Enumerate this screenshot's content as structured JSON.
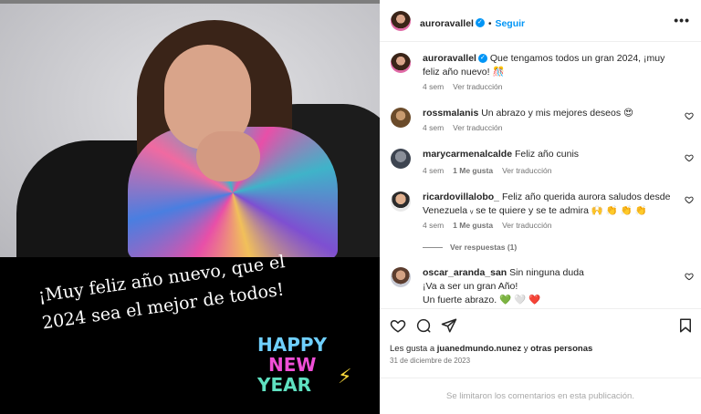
{
  "media": {
    "greeting_line1": "¡Muy feliz año nuevo, que el",
    "greeting_line2": "2024 sea el mejor de todos!",
    "badge_line1": "HAPPY",
    "badge_line2": "NEW",
    "badge_line3": "YEAR"
  },
  "header": {
    "username": "auroravallel",
    "follow_label": "Seguir",
    "more_icon": "more-horizontal-icon"
  },
  "caption": {
    "username": "auroravallel",
    "text": "Que tengamos todos un gran 2024, ¡muy feliz año nuevo! 🎊",
    "time": "4 sem",
    "translate": "Ver traducción"
  },
  "comments": [
    {
      "username": "rossmalanis",
      "text": "Un abrazo y mis mejores deseos 😍",
      "time": "4 sem",
      "likes": "",
      "translate": "Ver traducción"
    },
    {
      "username": "marycarmenalcalde",
      "text": "Feliz año cunis",
      "time": "4 sem",
      "likes": "1 Me gusta",
      "translate": "Ver traducción"
    },
    {
      "username": "ricardovillalobo_",
      "text": "Feliz año querida aurora saludos desde Venezuela ᵥ se te quiere y se te admira 🙌 👏 👏 👏",
      "time": "4 sem",
      "likes": "1 Me gusta",
      "translate": "Ver traducción",
      "replies": "Ver respuestas (1)"
    },
    {
      "username": "oscar_aranda_san",
      "text": "Sin ninguna duda",
      "text2": "¡Va a ser un gran Año!",
      "text3": "Un fuerte abrazo. 💚 🤍 ❤️"
    }
  ],
  "footer": {
    "likes_prefix": "Les gusta a",
    "likes_user": "juanedmundo.nunez",
    "likes_mid": "y",
    "likes_others": "otras personas",
    "date": "31 de diciembre de 2023",
    "comments_limited": "Se limitaron los comentarios en esta publicación."
  },
  "colors": {
    "accent": "#0095f6",
    "text": "#262626",
    "muted": "#737373"
  }
}
